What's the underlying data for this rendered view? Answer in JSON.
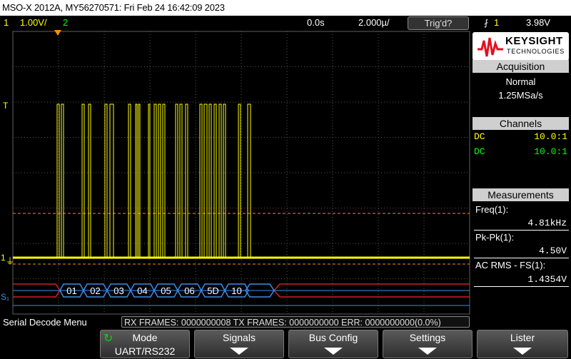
{
  "title": "MSO-X 2012A, MY56270571: Fri Feb 24 16:42:09 2023",
  "status": {
    "ch1_num": "1",
    "ch1_scale": "1.00V/",
    "ch2_num": "2",
    "time_offset": "0.0s",
    "timebase": "2.000µ/",
    "trigger_state": "Trig'd?",
    "trigger_source": "1",
    "trigger_level": "3.98V"
  },
  "logo": {
    "brand": "KEYSIGHT",
    "sub": "TECHNOLOGIES"
  },
  "acquisition": {
    "header": "Acquisition",
    "mode": "Normal",
    "rate": "1.25MSa/s"
  },
  "channels": {
    "header": "Channels",
    "rows": [
      {
        "coupling": "DC",
        "probe": "10.0:1",
        "color": "#ffff00"
      },
      {
        "coupling": "DC",
        "probe": "10.0:1",
        "color": "#00ff00"
      }
    ]
  },
  "measurements": {
    "header": "Measurements",
    "items": [
      {
        "label": "Freq(1):",
        "value": "4.81kHz"
      },
      {
        "label": "Pk-Pk(1):",
        "value": "4.50V"
      },
      {
        "label": "AC RMS - FS(1):",
        "value": "1.4354V"
      }
    ]
  },
  "decode": {
    "label": "S₁",
    "packets": [
      "01",
      "02",
      "03",
      "04",
      "05",
      "06",
      "5D",
      "10"
    ]
  },
  "markers": {
    "ch1": "1",
    "trigger": "T"
  },
  "bottom": {
    "menu_name": "Serial Decode Menu",
    "frames": "RX FRAMES: 0000000008  TX FRAMES: 0000000000  ERR: 0000000000(0.0%)"
  },
  "softkeys": [
    {
      "label": "Mode",
      "value": "UART/RS232"
    },
    {
      "label": "Signals",
      "value": ""
    },
    {
      "label": "Bus Config",
      "value": ""
    },
    {
      "label": "Settings",
      "value": ""
    },
    {
      "label": "Lister",
      "value": ""
    }
  ],
  "colors": {
    "ch1": "#ffff00",
    "ch2": "#00ff00",
    "decode_bus": "#3a8ee6",
    "idle_bus": "#d02020",
    "grid": "#505050"
  }
}
